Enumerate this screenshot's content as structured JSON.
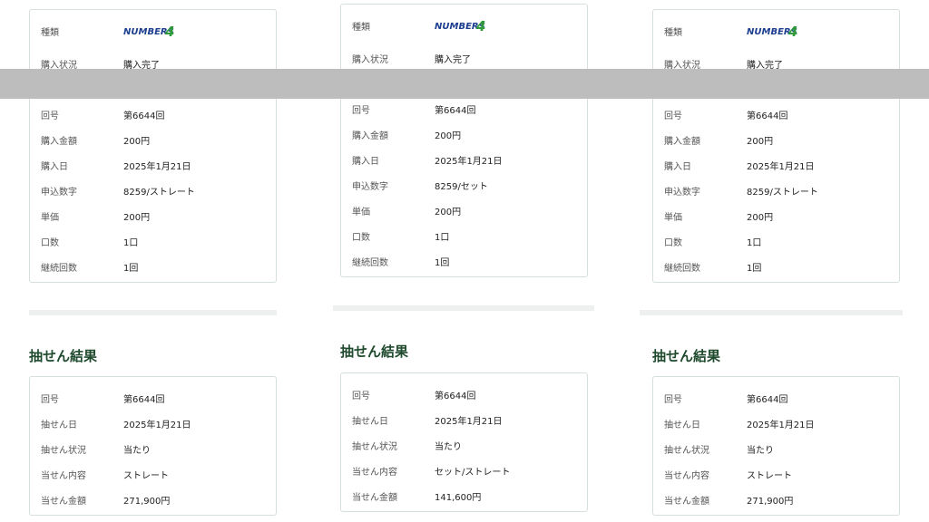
{
  "columns": [
    {
      "purchase": {
        "type_label": "種類",
        "product_logo": "NUMBERS4",
        "rows": [
          {
            "label": "購入状況",
            "value": "購入完了"
          },
          {
            "label": "回号",
            "value": "第6644回"
          },
          {
            "label": "購入金額",
            "value": "200円"
          },
          {
            "label": "購入日",
            "value": "2025年1月21日"
          },
          {
            "label": "申込数字",
            "value": "8259/ストレート"
          },
          {
            "label": "単価",
            "value": "200円"
          },
          {
            "label": "口数",
            "value": "1口"
          },
          {
            "label": "継続回数",
            "value": "1回"
          }
        ]
      },
      "result_title": "抽せん結果",
      "result_rows": [
        {
          "label": "回号",
          "value": "第6644回"
        },
        {
          "label": "抽せん日",
          "value": "2025年1月21日"
        },
        {
          "label": "抽せん状況",
          "value": "当たり"
        },
        {
          "label": "当せん内容",
          "value": "ストレート"
        },
        {
          "label": "当せん金額",
          "value": "271,900円"
        }
      ]
    },
    {
      "purchase": {
        "type_label": "種類",
        "product_logo": "NUMBERS4",
        "rows": [
          {
            "label": "購入状況",
            "value": "購入完了"
          },
          {
            "label": "回号",
            "value": "第6644回"
          },
          {
            "label": "購入金額",
            "value": "200円"
          },
          {
            "label": "購入日",
            "value": "2025年1月21日"
          },
          {
            "label": "申込数字",
            "value": "8259/セット"
          },
          {
            "label": "単価",
            "value": "200円"
          },
          {
            "label": "口数",
            "value": "1口"
          },
          {
            "label": "継続回数",
            "value": "1回"
          }
        ]
      },
      "result_title": "抽せん結果",
      "result_rows": [
        {
          "label": "回号",
          "value": "第6644回"
        },
        {
          "label": "抽せん日",
          "value": "2025年1月21日"
        },
        {
          "label": "抽せん状況",
          "value": "当たり"
        },
        {
          "label": "当せん内容",
          "value": "セット/ストレート"
        },
        {
          "label": "当せん金額",
          "value": "141,600円"
        }
      ]
    },
    {
      "purchase": {
        "type_label": "種類",
        "product_logo": "NUMBERS4",
        "rows": [
          {
            "label": "購入状況",
            "value": "購入完了"
          },
          {
            "label": "回号",
            "value": "第6644回"
          },
          {
            "label": "購入金額",
            "value": "200円"
          },
          {
            "label": "購入日",
            "value": "2025年1月21日"
          },
          {
            "label": "申込数字",
            "value": "8259/ストレート"
          },
          {
            "label": "単価",
            "value": "200円"
          },
          {
            "label": "口数",
            "value": "1口"
          },
          {
            "label": "継続回数",
            "value": "1回"
          }
        ]
      },
      "result_title": "抽せん結果",
      "result_rows": [
        {
          "label": "回号",
          "value": "第6644回"
        },
        {
          "label": "抽せん日",
          "value": "2025年1月21日"
        },
        {
          "label": "抽せん状況",
          "value": "当たり"
        },
        {
          "label": "当せん内容",
          "value": "ストレート"
        },
        {
          "label": "当せん金額",
          "value": "271,900円"
        }
      ]
    }
  ],
  "colors": {
    "section_title": "#1f4a2e",
    "card_border": "#d6dee0",
    "overlay_band": "#bdbdbd",
    "logo_blue": "#1d3f8f",
    "logo_green": "#2f9a3a"
  }
}
